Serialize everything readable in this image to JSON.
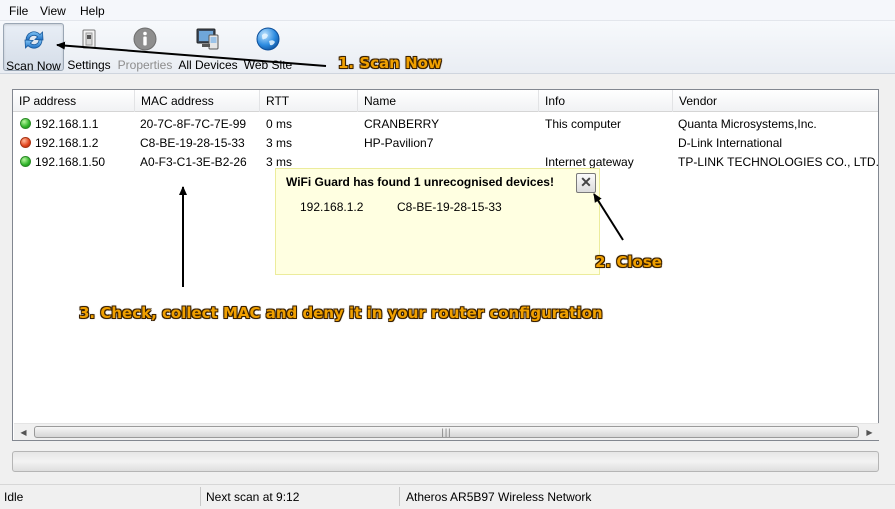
{
  "menu": {
    "items": [
      {
        "label": "File"
      },
      {
        "label": "View"
      },
      {
        "label": "Help"
      }
    ]
  },
  "toolbar": {
    "buttons": [
      {
        "label": "Scan Now",
        "icon": "refresh-icon",
        "state": "pressed"
      },
      {
        "label": "Settings",
        "icon": "settings-icon",
        "state": "enabled"
      },
      {
        "label": "Properties",
        "icon": "info-icon",
        "state": "disabled"
      },
      {
        "label": "All Devices",
        "icon": "devices-icon",
        "state": "enabled"
      },
      {
        "label": "Web Site",
        "icon": "globe-icon",
        "state": "enabled"
      }
    ]
  },
  "device_list": {
    "columns": [
      "IP address",
      "MAC address",
      "RTT",
      "Name",
      "Info",
      "Vendor"
    ],
    "rows": [
      {
        "status": "green",
        "ip": "192.168.1.1",
        "mac": "20-7C-8F-7C-7E-99",
        "rtt": "0 ms",
        "name": "CRANBERRY",
        "info": "This computer",
        "vendor": "Quanta Microsystems,Inc."
      },
      {
        "status": "red",
        "ip": "192.168.1.2",
        "mac": "C8-BE-19-28-15-33",
        "rtt": "3 ms",
        "name": "HP-Pavilion7",
        "info": "",
        "vendor": "D-Link International"
      },
      {
        "status": "green",
        "ip": "192.168.1.50",
        "mac": "A0-F3-C1-3E-B2-26",
        "rtt": "3 ms",
        "name": "",
        "info": "Internet gateway",
        "vendor": "TP-LINK TECHNOLOGIES CO., LTD."
      }
    ]
  },
  "popup": {
    "title": "WiFi Guard has found 1 unrecognised devices!",
    "close_label": "✕",
    "device": {
      "ip": "192.168.1.2",
      "mac": "C8-BE-19-28-15-33"
    }
  },
  "scrollbar": {
    "left_arrow": "◀",
    "right_arrow": "▶",
    "grip": "|||"
  },
  "progress": {
    "value": 0
  },
  "statusbar": {
    "status": "Idle",
    "next_scan": "Next scan at 9:12",
    "adapter": "Atheros AR5B97 Wireless Network"
  },
  "annotations": {
    "step1": "1. Scan Now",
    "step2": "2. Close",
    "step3": "3. Check, collect MAC and deny it in your router configuration"
  },
  "colors": {
    "annotation": "#f0a000",
    "status_ok": "#2fb52a",
    "status_unknown": "#e2431c",
    "popup_bg": "#ffffe1",
    "progress_fill": "#06b025"
  }
}
